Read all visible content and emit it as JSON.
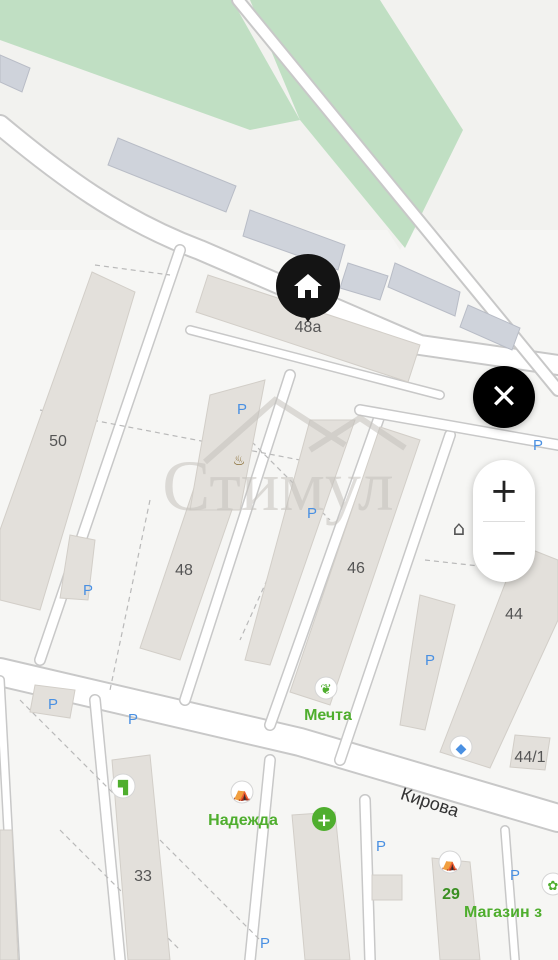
{
  "map": {
    "buildings": [
      {
        "id": "48a",
        "label": "48а"
      },
      {
        "id": "50",
        "label": "50"
      },
      {
        "id": "48",
        "label": "48"
      },
      {
        "id": "46",
        "label": "46"
      },
      {
        "id": "44",
        "label": "44"
      },
      {
        "id": "44-1",
        "label": "44/1"
      },
      {
        "id": "33",
        "label": "33"
      },
      {
        "id": "29",
        "label": "29"
      }
    ],
    "street": "Кирова",
    "pois": [
      {
        "name": "Мечта",
        "icon": "plant-icon"
      },
      {
        "name": "Надежда",
        "icon": "basket-icon"
      },
      {
        "name": "Магазин з",
        "icon": "paw-icon"
      },
      {
        "name": "",
        "icon": "pharmacy-cross-icon"
      },
      {
        "name": "",
        "icon": "paint-roller-icon"
      },
      {
        "name": "",
        "icon": "basket-icon"
      },
      {
        "name": "",
        "icon": "museum-icon"
      },
      {
        "name": "",
        "icon": "diamond-icon"
      },
      {
        "name": "",
        "icon": "fire-icon"
      }
    ],
    "parking_label": "P",
    "watermark": "Стимул"
  },
  "controls": {
    "close_label": "✕",
    "zoom_in_label": "+",
    "zoom_out_label": "−",
    "pin_icon": "home-icon"
  },
  "colors": {
    "background": "#f2f2ef",
    "building": "#e3e0db",
    "park": "#c0dfc3",
    "road": "#ffffff",
    "road_edge": "#c8c8c8",
    "poi_green": "#4fae2e",
    "parking_blue": "#4a90e2"
  }
}
